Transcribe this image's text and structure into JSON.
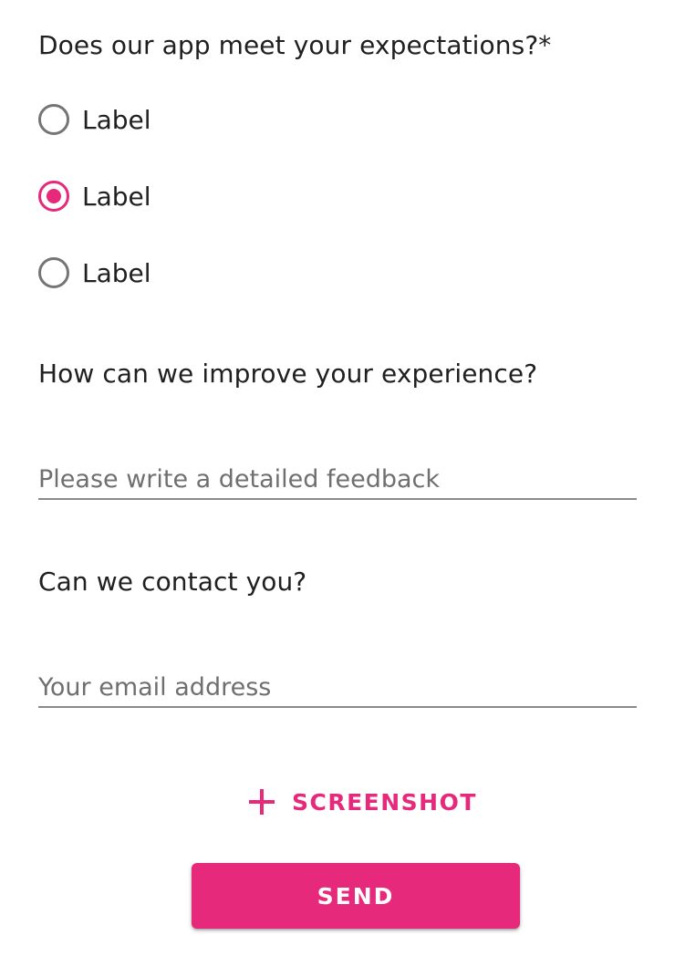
{
  "theme": {
    "accent_color": "#e6297a",
    "text_color": "#202020",
    "unselected_radio_color": "#757575",
    "underline_color": "#8a8a8a"
  },
  "form": {
    "expectation_question": "Does our app meet your expectations?*",
    "radio_options": [
      {
        "label": "Label",
        "selected": false
      },
      {
        "label": "Label",
        "selected": true
      },
      {
        "label": "Label",
        "selected": false
      }
    ],
    "improve_question": "How can we improve your experience?",
    "feedback_field": {
      "value": "",
      "placeholder": "Please write a detailed feedback"
    },
    "contact_question": "Can we contact you?",
    "email_field": {
      "value": "",
      "placeholder": "Your email address"
    }
  },
  "actions": {
    "screenshot_icon": "plus-icon",
    "screenshot_label": "SCREENSHOT",
    "send_label": "SEND"
  }
}
